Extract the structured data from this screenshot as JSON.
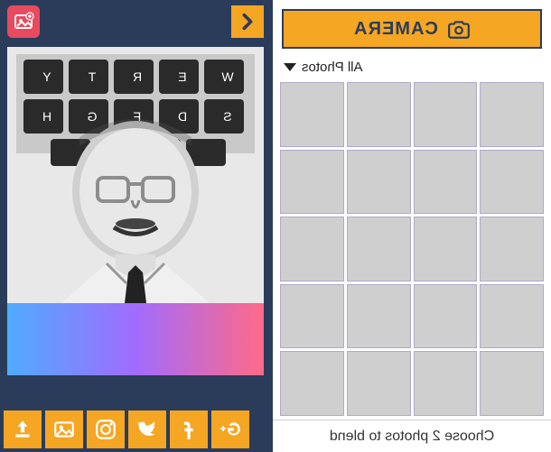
{
  "header": {
    "camera_label": "CAMERA",
    "album_label": "All Photos"
  },
  "toolbar": {
    "add_photo": "add-photo",
    "next": "next"
  },
  "share": {
    "upload": "upload",
    "gallery": "gallery",
    "instagram": "instagram",
    "twitter": "twitter",
    "facebook": "facebook",
    "google_plus": "google-plus"
  },
  "hint": {
    "text": "Choose 2 photos to blend"
  },
  "grid": {
    "rows": 5,
    "cols": 4
  },
  "accent_color": "#f5a623",
  "primary_color": "#2b3c5a",
  "danger_color": "#e84a5f"
}
